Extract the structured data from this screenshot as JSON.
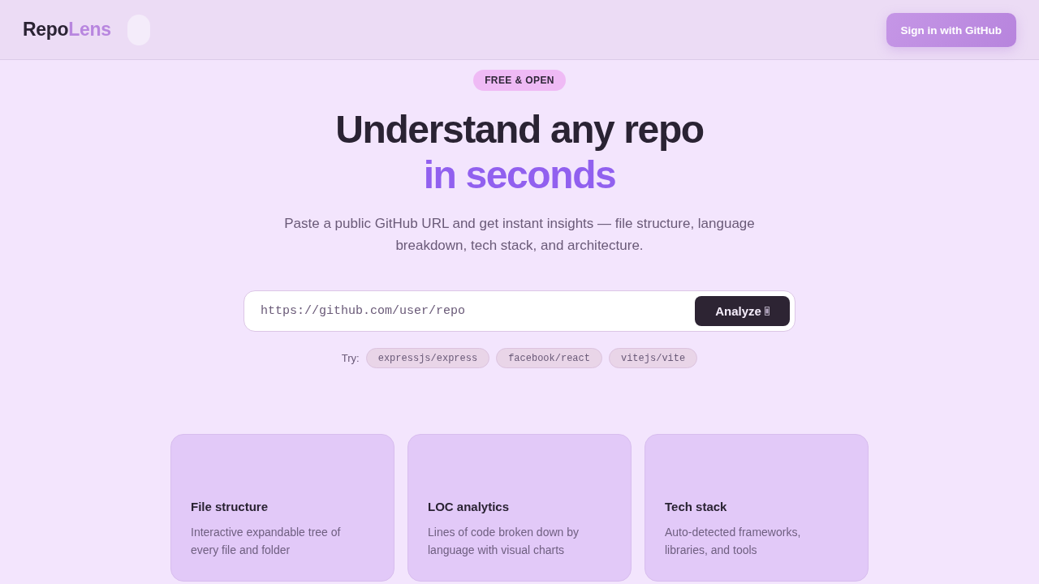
{
  "header": {
    "logo": {
      "text": "Repo",
      "accent": "Lens"
    },
    "sign_in_button": "Sign in with GitHub"
  },
  "hero": {
    "badge": "FREE & OPEN",
    "title": "Understand any repo",
    "title_accent": "in seconds",
    "subtitle": "Paste a public GitHub URL and get instant insights — file structure, language breakdown, tech stack, and architecture."
  },
  "search": {
    "placeholder": "https://github.com/user/repo",
    "button": "Analyze"
  },
  "try": {
    "label": "Try:",
    "examples": [
      "expressjs/express",
      "facebook/react",
      "vitejs/vite"
    ]
  },
  "features": [
    {
      "title": "File structure",
      "description": "Interactive expandable tree of every file and folder"
    },
    {
      "title": "LOC analytics",
      "description": "Lines of code broken down by language with visual charts"
    },
    {
      "title": "Tech stack",
      "description": "Auto-detected frameworks, libraries, and tools"
    }
  ]
}
